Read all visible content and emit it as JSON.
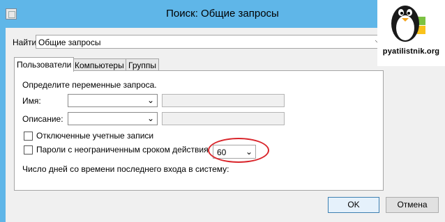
{
  "window": {
    "title": "Поиск: Общие запросы"
  },
  "find": {
    "label": "Найти:",
    "value": "Общие запросы"
  },
  "tabs": [
    {
      "label": "Пользователи",
      "active": true
    },
    {
      "label": "Компьютеры",
      "active": false
    },
    {
      "label": "Группы",
      "active": false
    }
  ],
  "panel": {
    "heading": "Определите переменные запроса.",
    "name_label": "Имя:",
    "description_label": "Описание:",
    "disabled_accounts_label": "Отключенные учетные записи",
    "non_expiring_passwords_label": "Пароли с неограниченным сроком действия",
    "days_label": "Число дней со времени последнего входа в систему:",
    "days_value": "60"
  },
  "buttons": {
    "ok": "OK",
    "cancel": "Отмена"
  },
  "logo": {
    "text": "pyatilistnik.org"
  },
  "colors": {
    "title_bar": "#5fb6e8",
    "highlight": "#d9252b",
    "window_bg": "#f0f0f0"
  },
  "icons": {
    "app": "saved-query-icon",
    "dropdown": "chevron-down-icon",
    "logo": "penguin-windows-logo"
  }
}
